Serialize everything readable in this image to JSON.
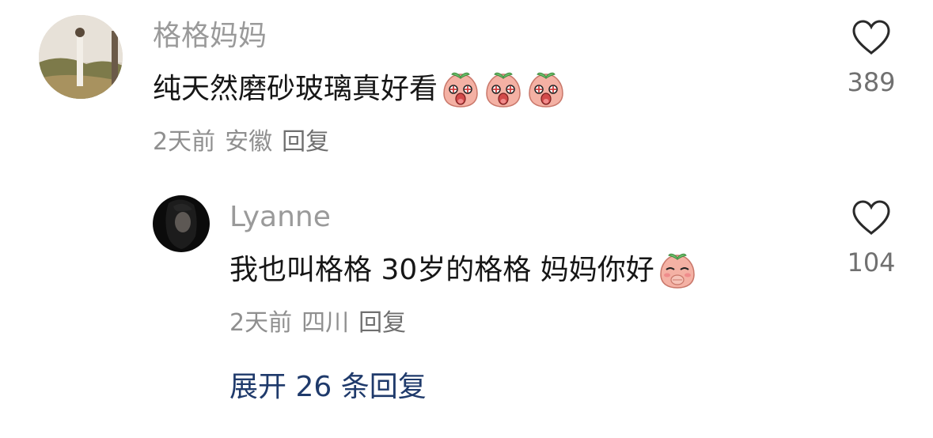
{
  "comment": {
    "username": "格格妈妈",
    "text": "纯天然磨砂玻璃真好看",
    "emojis": [
      "peach-emoji-starry-eyes",
      "peach-emoji-starry-eyes",
      "peach-emoji-starry-eyes"
    ],
    "time": "2天前",
    "location": "安徽",
    "reply_label": "回复",
    "likes": "389"
  },
  "reply": {
    "username": "Lyanne",
    "text": "我也叫格格 30岁的格格 妈妈你好",
    "emojis": [
      "peach-emoji-shy"
    ],
    "time": "2天前",
    "location": "四川",
    "reply_label": "回复",
    "likes": "104"
  },
  "expand_label": "展开 26 条回复",
  "colors": {
    "username": "#9a9a9a",
    "content": "#161616",
    "meta": "#8f8f8f",
    "expand_link": "#1f3a6b",
    "emoji_peach": "#f2a69a"
  }
}
